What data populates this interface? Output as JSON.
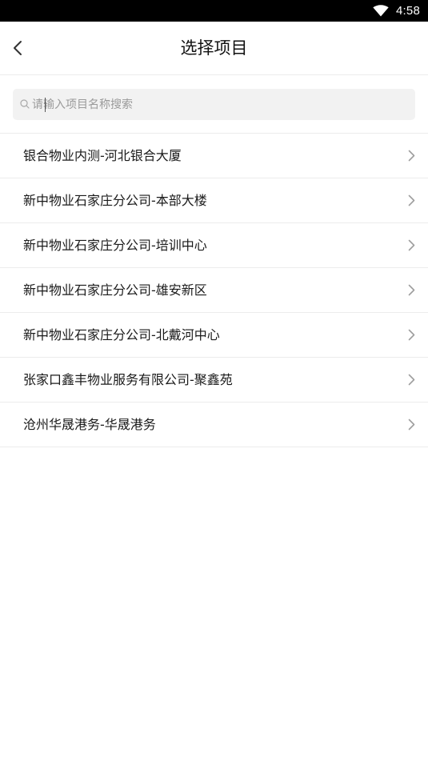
{
  "status_bar": {
    "time": "4:58",
    "wifi_icon": "wifi-icon"
  },
  "header": {
    "title": "选择项目",
    "back_icon": "chevron-left-icon"
  },
  "search": {
    "placeholder": "请输入项目名称搜索",
    "value": "",
    "icon": "search-icon"
  },
  "projects": [
    {
      "label": "银合物业内测-河北银合大厦"
    },
    {
      "label": "新中物业石家庄分公司-本部大楼"
    },
    {
      "label": "新中物业石家庄分公司-培训中心"
    },
    {
      "label": "新中物业石家庄分公司-雄安新区"
    },
    {
      "label": "新中物业石家庄分公司-北戴河中心"
    },
    {
      "label": "张家口鑫丰物业服务有限公司-聚鑫苑"
    },
    {
      "label": "沧州华晟港务-华晟港务"
    }
  ],
  "colors": {
    "status_bar_bg": "#000000",
    "search_bg": "#f2f2f2",
    "divider": "#ececec",
    "chevron": "#9e9e9e"
  }
}
